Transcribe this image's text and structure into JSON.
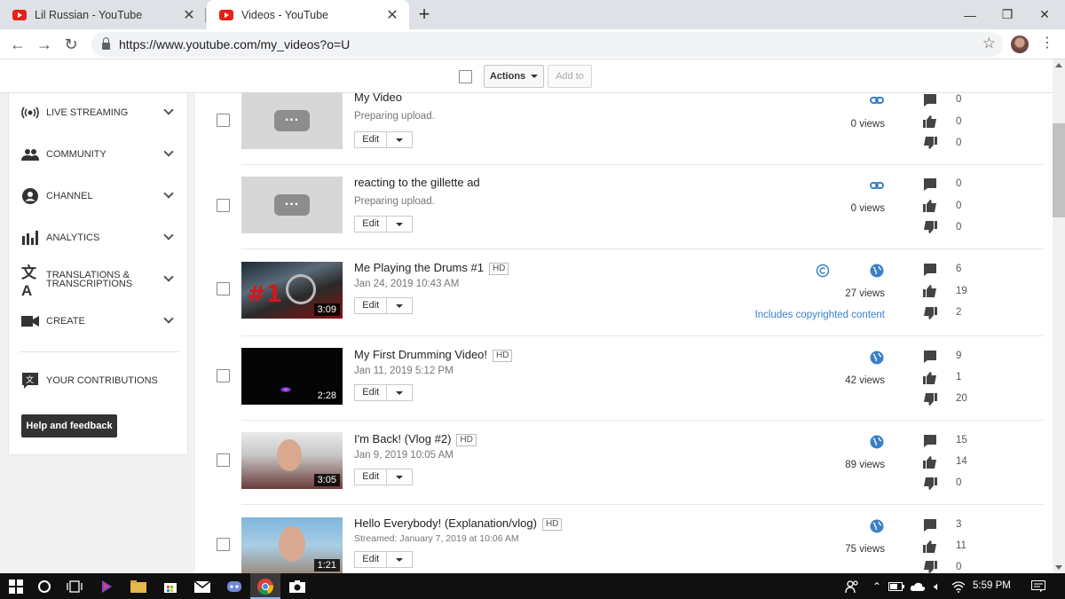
{
  "browser": {
    "tabs": [
      {
        "title": "Lil Russian - YouTube",
        "active": false
      },
      {
        "title": "Videos - YouTube",
        "active": true
      }
    ],
    "url": "https://www.youtube.com/my_videos?o=U"
  },
  "actionbar": {
    "actions_label": "Actions",
    "addto_label": "Add to"
  },
  "sidebar": {
    "items": [
      {
        "label": "LIVE STREAMING",
        "icon": "live-streaming-icon"
      },
      {
        "label": "COMMUNITY",
        "icon": "community-icon"
      },
      {
        "label": "CHANNEL",
        "icon": "channel-icon"
      },
      {
        "label": "ANALYTICS",
        "icon": "analytics-icon"
      },
      {
        "label": "TRANSLATIONS &\nTRANSCRIPTIONS",
        "icon": "translate-icon"
      },
      {
        "label": "CREATE",
        "icon": "camera-icon"
      }
    ],
    "contributions_label": "YOUR CONTRIBUTIONS",
    "help_label": "Help and feedback"
  },
  "videos": [
    {
      "title": "My Video",
      "hd": "",
      "subtitle": "Preparing upload.",
      "duration": "",
      "views": "0 views",
      "copyright": "",
      "privacy": "link",
      "comments": "0",
      "likes": "0",
      "dislikes": "0"
    },
    {
      "title": "reacting to the gillette ad",
      "hd": "",
      "subtitle": "Preparing upload.",
      "duration": "",
      "views": "0 views",
      "copyright": "",
      "privacy": "link",
      "comments": "0",
      "likes": "0",
      "dislikes": "0"
    },
    {
      "title": "Me Playing the Drums #1",
      "hd": "HD",
      "subtitle": "Jan 24, 2019 10:43 AM",
      "duration": "3:09",
      "views": "27 views",
      "copyright": "Includes copyrighted content",
      "privacy": "public",
      "comments": "6",
      "likes": "19",
      "dislikes": "2"
    },
    {
      "title": "My First Drumming Video!",
      "hd": "HD",
      "subtitle": "Jan 11, 2019 5:12 PM",
      "duration": "2:28",
      "views": "42 views",
      "copyright": "",
      "privacy": "public",
      "comments": "9",
      "likes": "1",
      "dislikes": "20"
    },
    {
      "title": "I'm Back! (Vlog #2)",
      "hd": "HD",
      "subtitle": "Jan 9, 2019 10:05 AM",
      "duration": "3:05",
      "views": "89 views",
      "copyright": "",
      "privacy": "public",
      "comments": "15",
      "likes": "14",
      "dislikes": "0"
    },
    {
      "title": "Hello Everybody! (Explanation/vlog)",
      "hd": "HD",
      "subtitle": "Streamed: January 7, 2019 at 10:06 AM",
      "duration": "1:21",
      "views": "75 views",
      "copyright": "",
      "privacy": "public",
      "comments": "3",
      "likes": "11",
      "dislikes": "0"
    }
  ],
  "edit_label": "Edit",
  "taskbar": {
    "time": "5:59 PM"
  },
  "colors": {
    "accent": "#3b80c6",
    "youtube_red": "#e62117"
  }
}
